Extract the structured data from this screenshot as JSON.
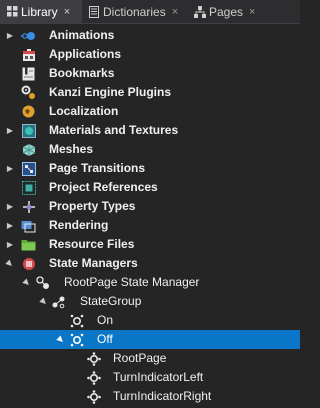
{
  "tabs": [
    {
      "label": "Library",
      "icon": "grid-icon",
      "close": "×",
      "active": true
    },
    {
      "label": "Dictionaries",
      "icon": "dictionary-icon",
      "close": "×",
      "active": false
    },
    {
      "label": "Pages",
      "icon": "pages-tree-icon",
      "close": "×",
      "active": false
    }
  ],
  "tree": {
    "items": [
      {
        "label": "Animations",
        "icon": "animations-icon",
        "expander": "collapsed"
      },
      {
        "label": "Applications",
        "icon": "applications-icon",
        "expander": "none"
      },
      {
        "label": "Bookmarks",
        "icon": "bookmarks-icon",
        "expander": "none"
      },
      {
        "label": "Kanzi Engine Plugins",
        "icon": "plugins-icon",
        "expander": "none"
      },
      {
        "label": "Localization",
        "icon": "localization-icon",
        "expander": "none"
      },
      {
        "label": "Materials and Textures",
        "icon": "materials-icon",
        "expander": "collapsed"
      },
      {
        "label": "Meshes",
        "icon": "meshes-icon",
        "expander": "none"
      },
      {
        "label": "Page Transitions",
        "icon": "page-transitions-icon",
        "expander": "collapsed"
      },
      {
        "label": "Project References",
        "icon": "project-references-icon",
        "expander": "none"
      },
      {
        "label": "Property Types",
        "icon": "property-types-icon",
        "expander": "collapsed"
      },
      {
        "label": "Rendering",
        "icon": "rendering-icon",
        "expander": "collapsed"
      },
      {
        "label": "Resource Files",
        "icon": "folder-icon",
        "expander": "collapsed"
      },
      {
        "label": "State Managers",
        "icon": "state-managers-icon",
        "expander": "expanded"
      },
      {
        "label": "RootPage State Manager",
        "icon": "state-manager-icon",
        "expander": "expanded"
      },
      {
        "label": "StateGroup",
        "icon": "state-group-icon",
        "expander": "expanded"
      },
      {
        "label": "On",
        "icon": "state-icon",
        "expander": "none"
      },
      {
        "label": "Off",
        "icon": "state-icon",
        "expander": "expanded",
        "selected": true
      },
      {
        "label": "RootPage",
        "icon": "state-object-icon",
        "expander": "none"
      },
      {
        "label": "TurnIndicatorLeft",
        "icon": "state-object-icon",
        "expander": "none"
      },
      {
        "label": "TurnIndicatorRight",
        "icon": "state-object-icon",
        "expander": "none"
      }
    ]
  },
  "colors": {
    "background": "#252526",
    "selection": "#0a76c8",
    "tab_active": "#3e3e42"
  }
}
